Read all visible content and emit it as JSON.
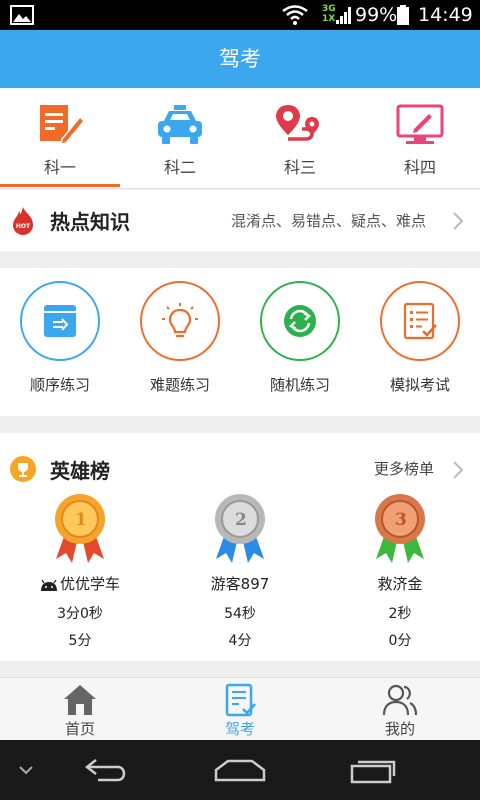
{
  "status_bar": {
    "network_label": "3G\n1X",
    "battery_text": "99%",
    "time": "14:49"
  },
  "header": {
    "title": "驾考"
  },
  "subject_tabs": [
    {
      "label": "科一",
      "icon": "exam-paper-pen-icon",
      "color": "#f06a2a",
      "selected": true
    },
    {
      "label": "科二",
      "icon": "car-icon",
      "color": "#3aa7ee",
      "selected": false
    },
    {
      "label": "科三",
      "icon": "route-pin-icon",
      "color": "#e03a4a",
      "selected": false
    },
    {
      "label": "科四",
      "icon": "monitor-pen-icon",
      "color": "#e8457a",
      "selected": false
    }
  ],
  "hot_knowledge": {
    "badge": "HOT",
    "title": "热点知识",
    "desc": "混淆点、易错点、疑点、难点"
  },
  "practice": [
    {
      "label": "顺序练习",
      "icon": "sequence-icon",
      "color": "#3aa7ee"
    },
    {
      "label": "难题练习",
      "icon": "lightbulb-icon",
      "color": "#f06a2a"
    },
    {
      "label": "随机练习",
      "icon": "shuffle-icon",
      "color": "#2bb24c"
    },
    {
      "label": "模拟考试",
      "icon": "checklist-icon",
      "color": "#f06a2a"
    }
  ],
  "hero_board": {
    "title": "英雄榜",
    "more": "更多榜单",
    "rankers": [
      {
        "rank": "1",
        "name": "优优学车",
        "time": "3分0秒",
        "score": "5分",
        "medal": "gold",
        "color": "#f5a32a"
      },
      {
        "rank": "2",
        "name": "游客897",
        "time": "54秒",
        "score": "4分",
        "medal": "silver",
        "color": "#b8b8b8"
      },
      {
        "rank": "3",
        "name": "救济金",
        "time": "2秒",
        "score": "0分",
        "medal": "bronze",
        "color": "#d9774a"
      }
    ]
  },
  "bottom_nav": [
    {
      "label": "首页",
      "icon": "home-icon",
      "active": false
    },
    {
      "label": "驾考",
      "icon": "exam-list-icon",
      "active": true
    },
    {
      "label": "我的",
      "icon": "users-icon",
      "active": false
    }
  ],
  "colors": {
    "primary": "#3aa7ee",
    "accent": "#f06a2a"
  }
}
